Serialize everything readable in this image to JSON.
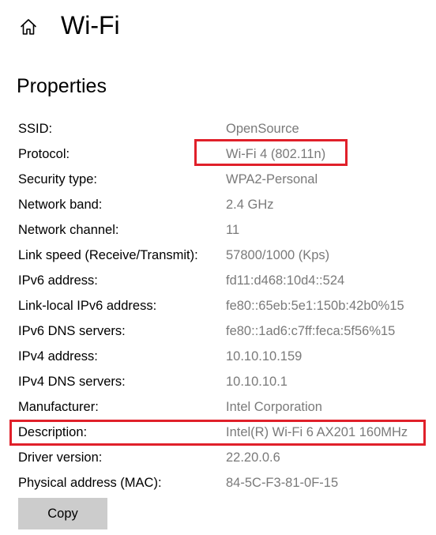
{
  "header": {
    "title": "Wi-Fi",
    "home_icon": "home-icon"
  },
  "section": {
    "title": "Properties"
  },
  "properties": [
    {
      "label": "SSID:",
      "value": "OpenSource"
    },
    {
      "label": "Protocol:",
      "value": "Wi-Fi 4 (802.11n)"
    },
    {
      "label": "Security type:",
      "value": "WPA2-Personal"
    },
    {
      "label": "Network band:",
      "value": "2.4 GHz"
    },
    {
      "label": "Network channel:",
      "value": "11"
    },
    {
      "label": "Link speed (Receive/Transmit):",
      "value": "57800/1000 (Kps)"
    },
    {
      "label": "IPv6 address:",
      "value": "fd11:d468:10d4::524"
    },
    {
      "label": "Link-local IPv6 address:",
      "value": "fe80::65eb:5e1:150b:42b0%15"
    },
    {
      "label": "IPv6 DNS servers:",
      "value": "fe80::1ad6:c7ff:feca:5f56%15"
    },
    {
      "label": "IPv4 address:",
      "value": "10.10.10.159"
    },
    {
      "label": "IPv4 DNS servers:",
      "value": "10.10.10.1"
    },
    {
      "label": "Manufacturer:",
      "value": "Intel Corporation"
    },
    {
      "label": "Description:",
      "value": "Intel(R) Wi-Fi 6 AX201 160MHz"
    },
    {
      "label": "Driver version:",
      "value": "22.20.0.6"
    },
    {
      "label": "Physical address (MAC):",
      "value": "84-5C-F3-81-0F-15"
    }
  ],
  "actions": {
    "copy_label": "Copy"
  },
  "colors": {
    "label": "#000000",
    "value": "#7a7a7a",
    "highlight": "#e0202a",
    "button_bg": "#cccccc"
  }
}
